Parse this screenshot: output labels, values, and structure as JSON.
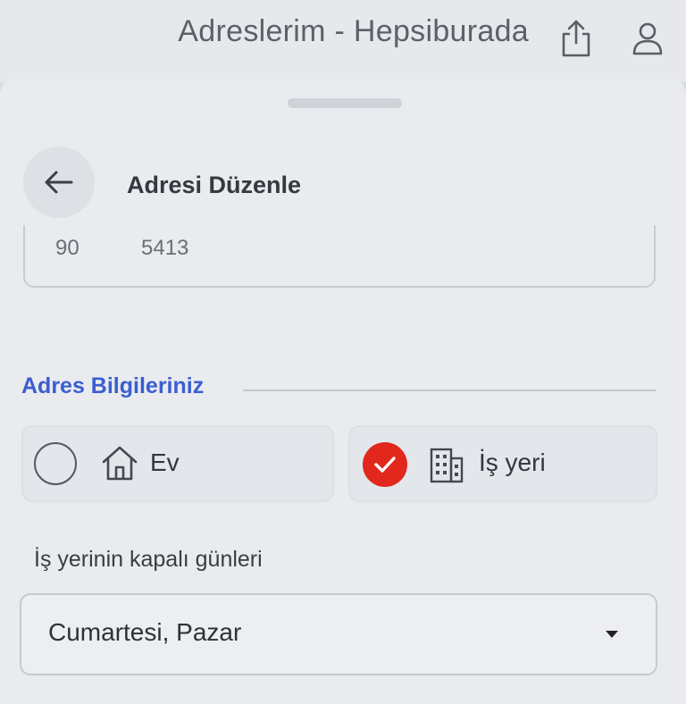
{
  "browser": {
    "title": "Adreslerim - Hepsiburada",
    "icons": [
      "share-icon",
      "user-icon"
    ]
  },
  "sheet": {
    "title": "Adresi Düzenle",
    "back_icon": "arrow-left-icon"
  },
  "phone_field": {
    "code": "90",
    "number_fragment": "5413"
  },
  "address_section": {
    "title": "Adres Bilgileriniz",
    "options": [
      {
        "label": "Ev",
        "icon": "home-icon",
        "selected": false
      },
      {
        "label": "İş yeri",
        "icon": "building-icon",
        "selected": true
      }
    ],
    "closed_days_label": "İş yerinin kapalı günleri",
    "closed_days_value": "Cumartesi, Pazar"
  },
  "colors": {
    "accent_blue": "#3b5ed0",
    "selected_red": "#e2271d"
  }
}
